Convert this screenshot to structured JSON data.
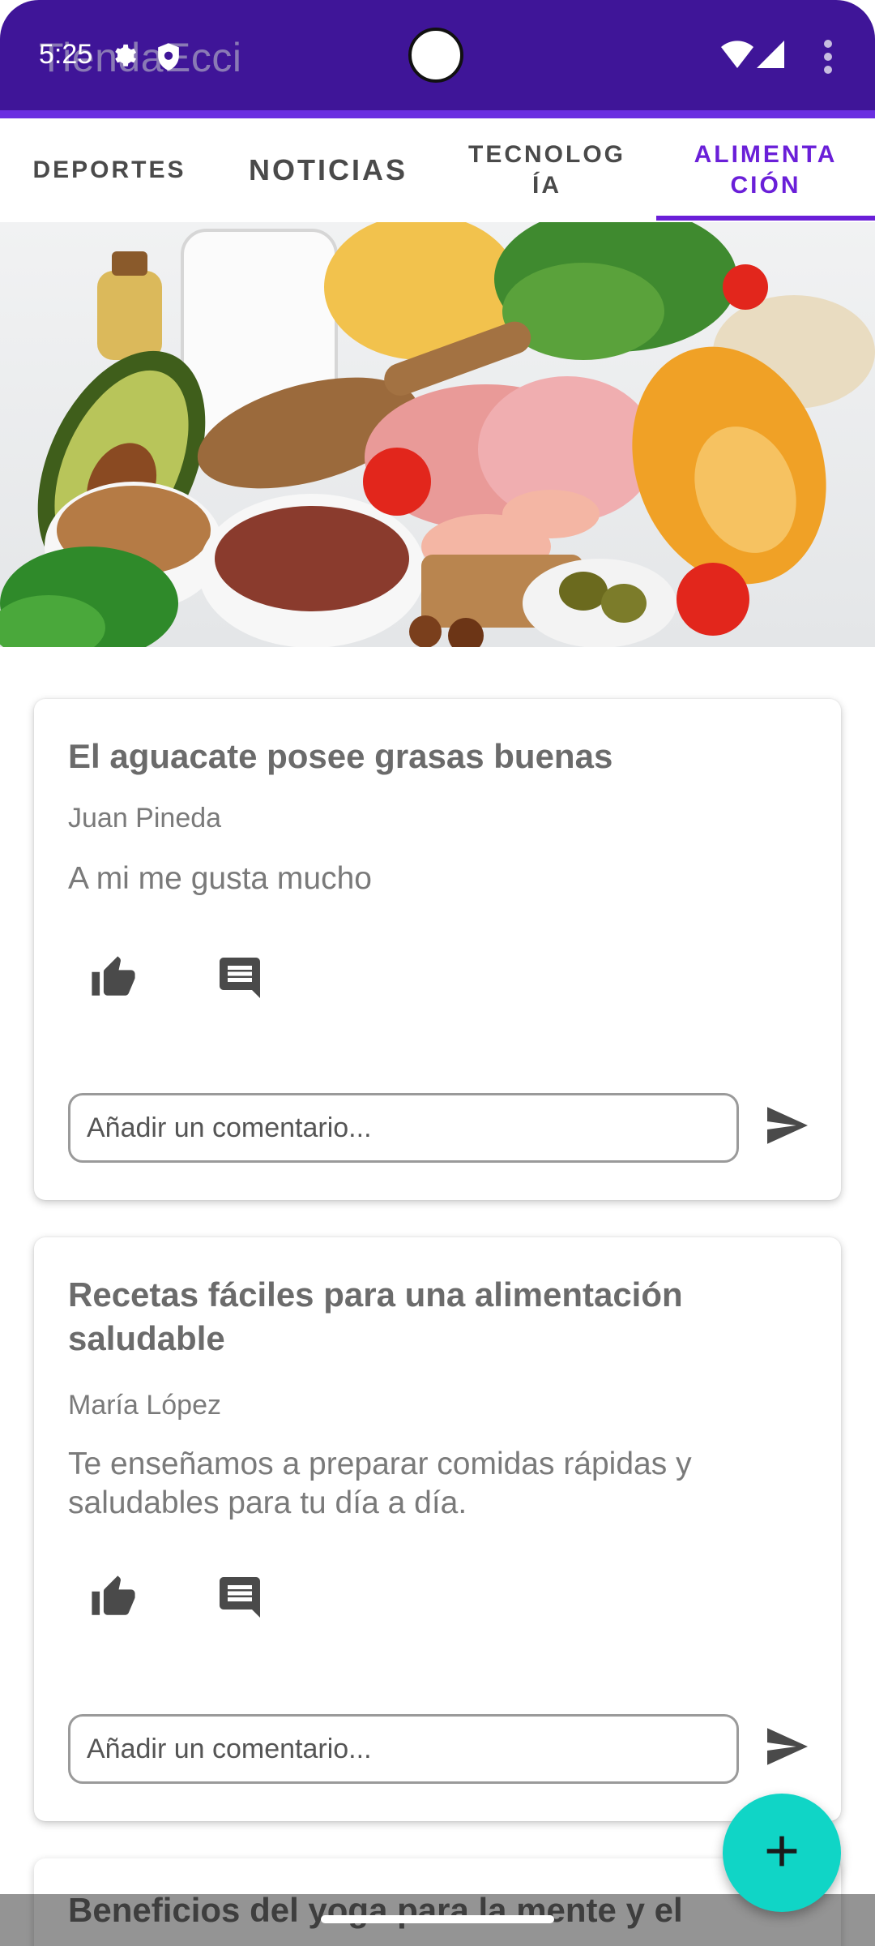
{
  "status_bar": {
    "time": "5:25"
  },
  "app_bar": {
    "title": "TiendaEcci"
  },
  "tabs": [
    {
      "label": "DEPORTES"
    },
    {
      "label": "NOTICIAS"
    },
    {
      "label": "TECNOLOGÍA"
    },
    {
      "label": "ALIMENTACIÓN"
    }
  ],
  "active_tab": "ALIMENTACIÓN",
  "colors": {
    "app_bar": "#3f1598",
    "accent": "#6a1fd8",
    "fab": "#10d5c6"
  },
  "banner": {
    "icon": "food-photo"
  },
  "posts": [
    {
      "title": "El aguacate posee grasas buenas",
      "author": "Juan Pineda",
      "body": "A mi me gusta mucho",
      "comment_placeholder": "Añadir un comentario..."
    },
    {
      "title": "Recetas fáciles para una alimentación saludable",
      "author": "María López",
      "body": "Te enseñamos a preparar comidas rápidas y saludables para tu día a día.",
      "comment_placeholder": "Añadir un comentario..."
    },
    {
      "title": "Beneficios del yoga para la mente y el"
    }
  ],
  "icons": {
    "like": "thumb-up-icon",
    "comment": "comment-icon",
    "send": "send-icon",
    "add": "plus-icon"
  }
}
